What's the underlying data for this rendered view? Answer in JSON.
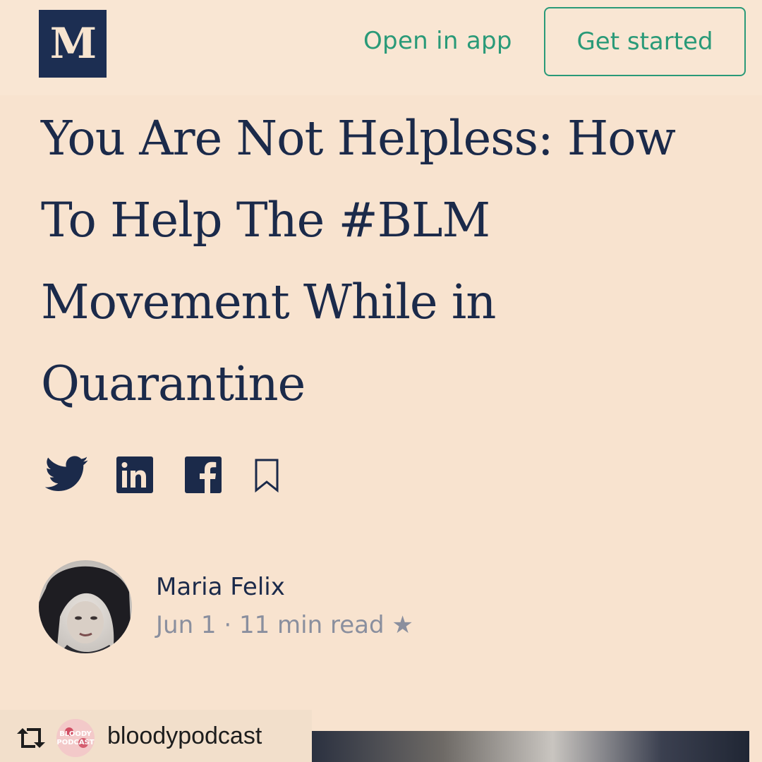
{
  "header": {
    "logo_text": "M",
    "open_in_app": "Open in app",
    "get_started": "Get started"
  },
  "article": {
    "title": "You Are Not Helpless: How To Help The #BLM Movement While in Quarantine",
    "share_icons": [
      "twitter-icon",
      "linkedin-icon",
      "facebook-icon",
      "bookmark-icon"
    ],
    "author": {
      "name": "Maria Felix",
      "meta": "Jun 1 · 11 min read ★"
    }
  },
  "repost": {
    "username": "bloodypodcast",
    "badge_text": "BLOODY PODCAST"
  },
  "colors": {
    "background": "#f8e3cf",
    "brand_navy": "#1c2e52",
    "accent_green": "#2a9a78",
    "meta_gray": "#8a8f9e"
  }
}
